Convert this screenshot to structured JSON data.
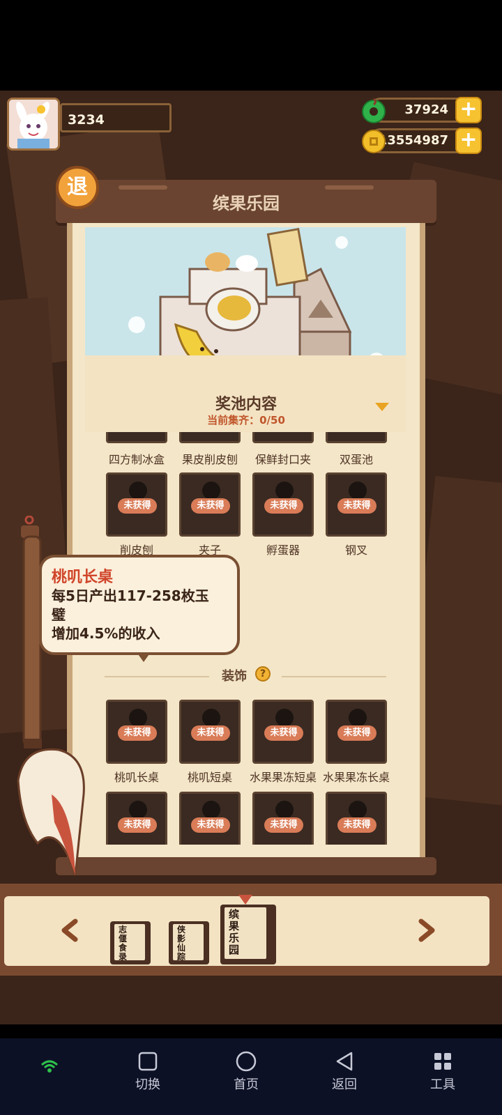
{
  "player": {
    "score": "3234"
  },
  "currency": {
    "jade": "37924",
    "coins": "13554987",
    "plus": "+"
  },
  "exit_label": "退",
  "album": {
    "title": "缤果乐园"
  },
  "pool": {
    "title": "奖池内容",
    "progress": "当前集齐：0/50"
  },
  "locked_badge": "未获得",
  "items_row1": [
    "四方制冰盒",
    "果皮削皮刨",
    "保鲜封口夹",
    "双蛋池"
  ],
  "items_row2": [
    "削皮刨",
    "夹子",
    "孵蛋器",
    "钢叉"
  ],
  "section_decor": "装饰",
  "question_mark": "?",
  "decor_row1": [
    "桃叽长桌",
    "桃叽短桌",
    "水果果冻短桌",
    "水果果冻长桌"
  ],
  "tooltip": {
    "title": "桃叽长桌",
    "line1": "每5日产出117-258枚玉",
    "line2": "璧",
    "line3": "增加4.5%的收入"
  },
  "books": [
    {
      "label": "志偃食录"
    },
    {
      "label": "侠影仙踪"
    },
    {
      "label": "缤果乐园"
    }
  ],
  "nav": {
    "switch": "切换",
    "home": "首页",
    "back": "返回",
    "tools": "工具"
  },
  "colors": {
    "accent_orange": "#d97c57",
    "title_red": "#d0452a",
    "paper": "#f4e6c8",
    "wood": "#6a4430"
  }
}
